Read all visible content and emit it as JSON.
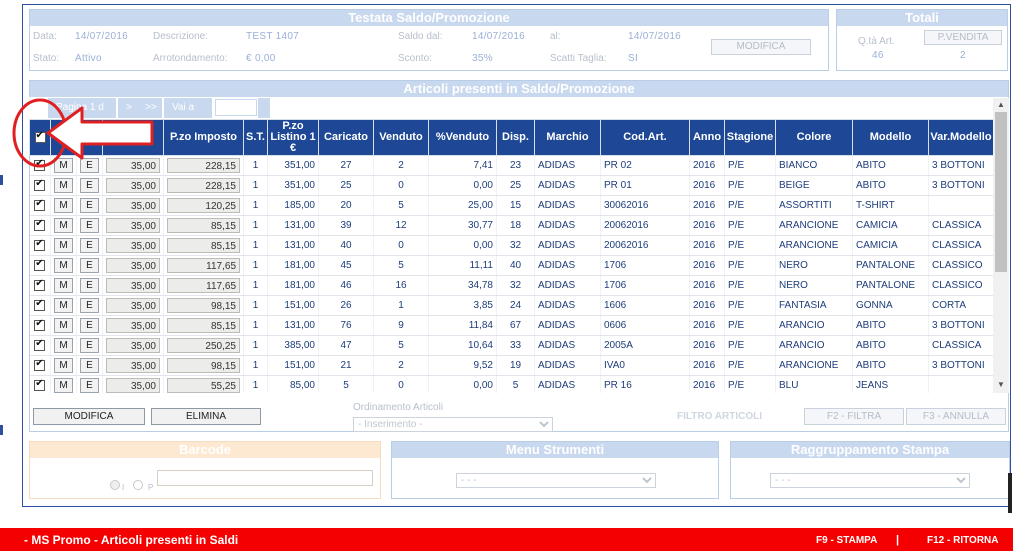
{
  "header": {
    "title": "Testata Saldo/Promozione",
    "data_label": "Data:",
    "data_value": "14/07/2016",
    "descrizione_label": "Descrizione:",
    "descrizione_value": "TEST 1407",
    "saldo_dal_label": "Saldo dal:",
    "saldo_dal_value": "14/07/2016",
    "al_label": "al:",
    "al_value": "14/07/2016",
    "stato_label": "Stato:",
    "stato_value": "Attivo",
    "arrotondamento_label": "Arrotondamento:",
    "arrotondamento_value": "€ 0,00",
    "sconto_label": "Sconto:",
    "sconto_value": "35%",
    "scatti_label": "Scatti Taglia:",
    "scatti_value": "SI",
    "modifica_label": "MODIFICA"
  },
  "totali": {
    "title": "Totali",
    "qta_label": "Q.tà Art.",
    "qta_value": "46",
    "pvendita_label": "P.VENDITA",
    "pvendita_value": "2"
  },
  "articoli": {
    "title": "Articoli presenti in Saldo/Promozione",
    "pagina_label": "Pagina 1 d",
    "next": ">",
    "last": ">>",
    "vai_label": "Vai a"
  },
  "grid": {
    "columns": [
      "",
      "",
      "",
      "",
      "P.zo Imposto",
      "S.T.",
      "P.zo Listino 1 €",
      "Caricato",
      "Venduto",
      "%Venduto",
      "Disp.",
      "Marchio",
      "Cod.Art.",
      "Anno",
      "Stagione",
      "Colore",
      "Modello",
      "Var.Modello"
    ],
    "m_label": "M",
    "e_label": "E",
    "rows": [
      [
        "35,00",
        "228,15",
        "1",
        "351,00",
        "27",
        "2",
        "7,41",
        "23",
        "ADIDAS",
        "PR 02",
        "2016",
        "P/E",
        "BIANCO",
        "ABITO",
        "3 BOTTONI"
      ],
      [
        "35,00",
        "228,15",
        "1",
        "351,00",
        "25",
        "0",
        "0,00",
        "25",
        "ADIDAS",
        "PR 01",
        "2016",
        "P/E",
        "BEIGE",
        "ABITO",
        "3 BOTTONI"
      ],
      [
        "35,00",
        "120,25",
        "1",
        "185,00",
        "20",
        "5",
        "25,00",
        "15",
        "ADIDAS",
        "30062016",
        "2016",
        "P/E",
        "ASSORTITI",
        "T-SHIRT",
        ""
      ],
      [
        "35,00",
        "85,15",
        "1",
        "131,00",
        "39",
        "12",
        "30,77",
        "18",
        "ADIDAS",
        "20062016",
        "2016",
        "P/E",
        "ARANCIONE",
        "CAMICIA",
        "CLASSICA"
      ],
      [
        "35,00",
        "85,15",
        "1",
        "131,00",
        "40",
        "0",
        "0,00",
        "32",
        "ADIDAS",
        "20062016",
        "2016",
        "P/E",
        "ARANCIONE",
        "CAMICIA",
        "CLASSICA"
      ],
      [
        "35,00",
        "117,65",
        "1",
        "181,00",
        "45",
        "5",
        "11,11",
        "40",
        "ADIDAS",
        "1706",
        "2016",
        "P/E",
        "NERO",
        "PANTALONE",
        "CLASSICO"
      ],
      [
        "35,00",
        "117,65",
        "1",
        "181,00",
        "46",
        "16",
        "34,78",
        "32",
        "ADIDAS",
        "1706",
        "2016",
        "P/E",
        "NERO",
        "PANTALONE",
        "CLASSICO"
      ],
      [
        "35,00",
        "98,15",
        "1",
        "151,00",
        "26",
        "1",
        "3,85",
        "24",
        "ADIDAS",
        "1606",
        "2016",
        "P/E",
        "FANTASIA",
        "GONNA",
        "CORTA"
      ],
      [
        "35,00",
        "85,15",
        "1",
        "131,00",
        "76",
        "9",
        "11,84",
        "67",
        "ADIDAS",
        "0606",
        "2016",
        "P/E",
        "ARANCIO",
        "ABITO",
        "3 BOTTONI"
      ],
      [
        "35,00",
        "250,25",
        "1",
        "385,00",
        "47",
        "5",
        "10,64",
        "33",
        "ADIDAS",
        "2005A",
        "2016",
        "P/E",
        "ARANCIO",
        "ABITO",
        "CLASSICA"
      ],
      [
        "35,00",
        "98,15",
        "1",
        "151,00",
        "21",
        "2",
        "9,52",
        "19",
        "ADIDAS",
        "IVA0",
        "2016",
        "P/E",
        "ARANCIONE",
        "ABITO",
        "3 BOTTONI"
      ],
      [
        "35,00",
        "55,25",
        "1",
        "85,00",
        "5",
        "0",
        "0,00",
        "5",
        "ADIDAS",
        "PR 16",
        "2016",
        "P/E",
        "BLU",
        "JEANS",
        ""
      ]
    ]
  },
  "actions": {
    "modifica": "MODIFICA",
    "elimina": "ELIMINA",
    "ordinamento_label": "Ordinamento Articoli",
    "ordinamento_value": "- Inserimento -",
    "filtro": "FILTRO ARTICOLI",
    "f2": "F2 - FILTRA",
    "f3": "F3 - ANNULLA"
  },
  "barcode": {
    "title": "Barcode",
    "opt_i": "I",
    "opt_p": "P"
  },
  "menu_strumenti": {
    "title": "Menu Strumenti",
    "value": "- - -"
  },
  "raggruppamento": {
    "title": "Raggruppamento Stampa",
    "value": "- - -"
  },
  "footer": {
    "title": "- MS Promo - Articoli presenti in Saldi",
    "f9": "F9 - STAMPA",
    "sep": "|",
    "f12": "F12 - RITORNA"
  },
  "colors": {
    "header_blue": "#1e4896",
    "panel_title": "#c8d8ee",
    "footer_red": "#f40000",
    "annotation_red": "#e02020"
  }
}
